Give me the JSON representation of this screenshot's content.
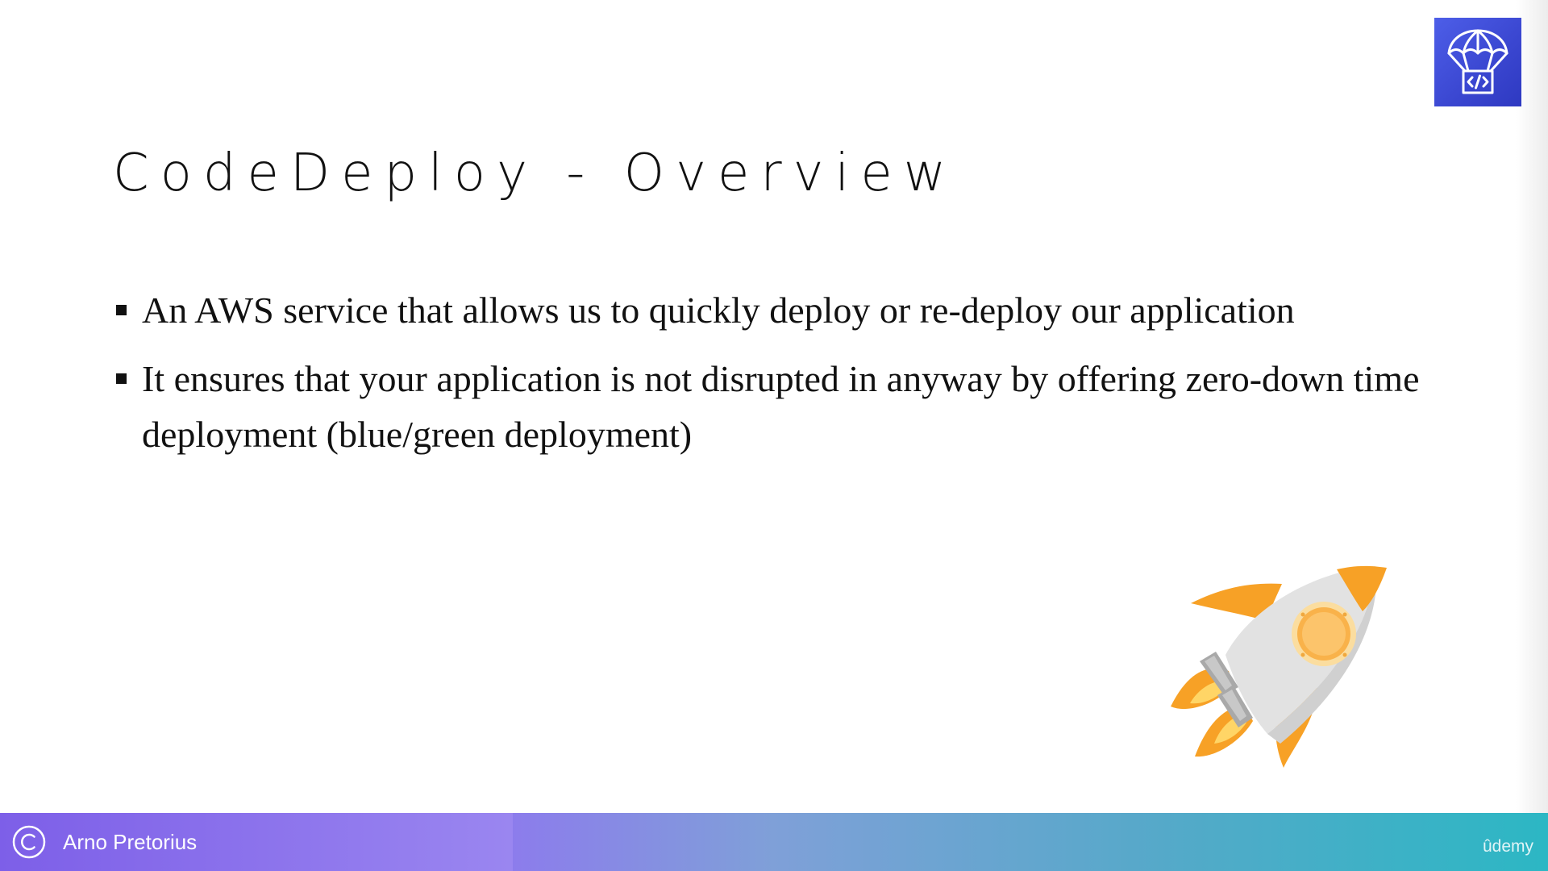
{
  "slide": {
    "title": "CodeDeploy - Overview",
    "bullets": [
      "An AWS service that allows us to quickly deploy or re-deploy our application",
      "It ensures that your application is not disrupted in anyway by offering zero-down time deployment (blue/green deployment)"
    ]
  },
  "logo": {
    "icon": "aws-codedeploy-icon",
    "color": "#3f4fd8"
  },
  "illustration": {
    "icon": "rocket-icon",
    "accent_color": "#f7a126"
  },
  "footer": {
    "icon": "copyright-icon",
    "author": "Arno Pretorius",
    "watermark": "ûdemy"
  }
}
